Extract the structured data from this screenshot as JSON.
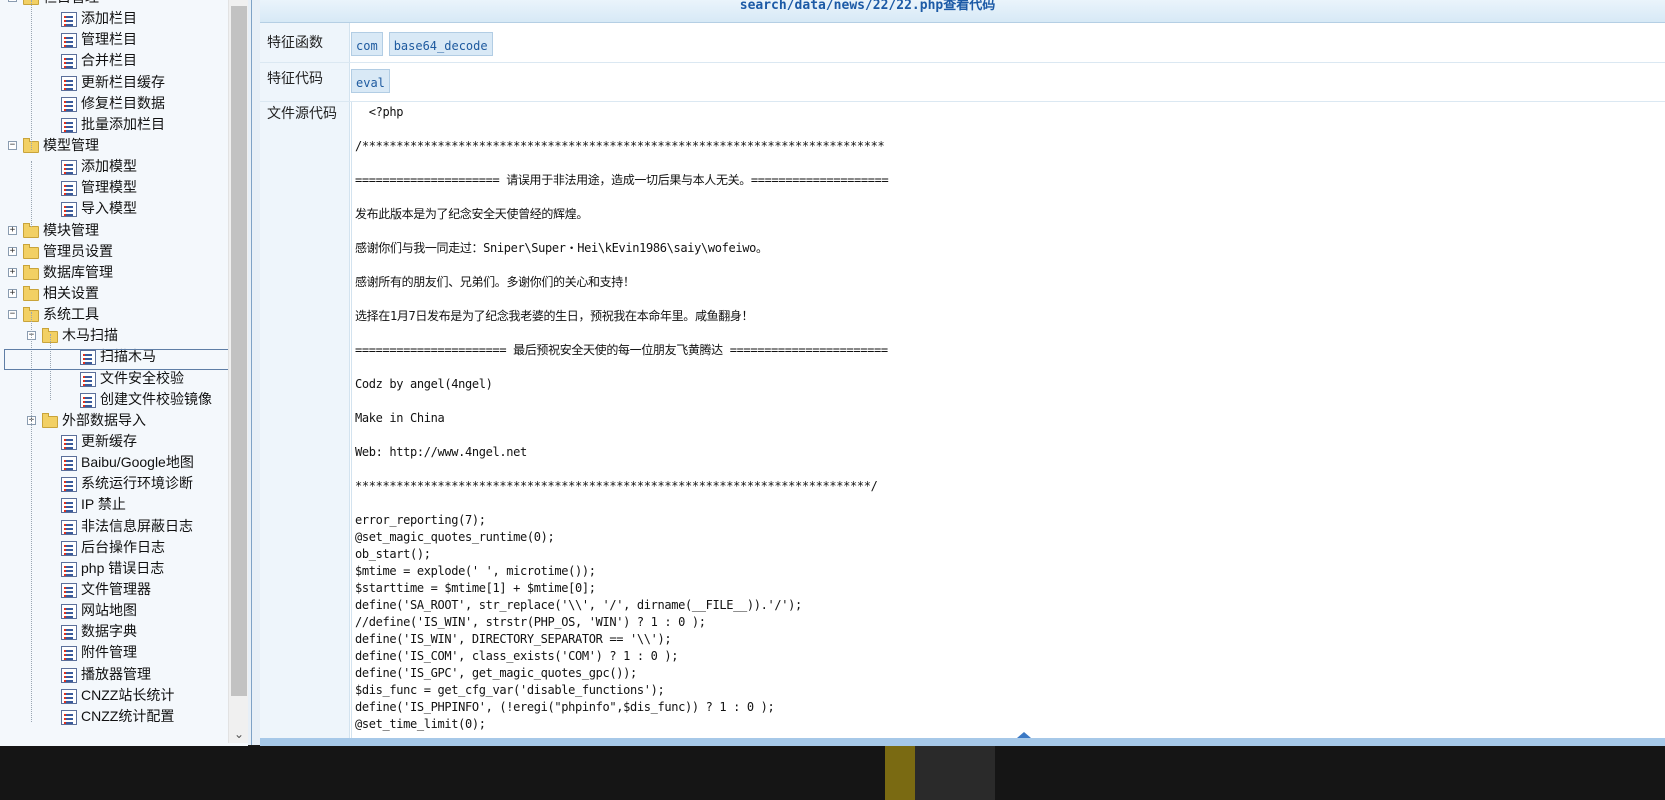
{
  "tree": {
    "items": [
      {
        "label": "栏目管理",
        "type": "folder",
        "level": 0,
        "expander": "−"
      },
      {
        "label": "添加栏目",
        "type": "page",
        "level": 1
      },
      {
        "label": "管理栏目",
        "type": "page",
        "level": 1
      },
      {
        "label": "合并栏目",
        "type": "page",
        "level": 1
      },
      {
        "label": "更新栏目缓存",
        "type": "page",
        "level": 1
      },
      {
        "label": "修复栏目数据",
        "type": "page",
        "level": 1
      },
      {
        "label": "批量添加栏目",
        "type": "page",
        "level": 1
      },
      {
        "label": "模型管理",
        "type": "folder",
        "level": 0,
        "expander": "−"
      },
      {
        "label": "添加模型",
        "type": "page",
        "level": 1
      },
      {
        "label": "管理模型",
        "type": "page",
        "level": 1
      },
      {
        "label": "导入模型",
        "type": "page",
        "level": 1
      },
      {
        "label": "模块管理",
        "type": "folder",
        "level": 0,
        "expander": "+"
      },
      {
        "label": "管理员设置",
        "type": "folder",
        "level": 0,
        "expander": "+"
      },
      {
        "label": "数据库管理",
        "type": "folder",
        "level": 0,
        "expander": "+"
      },
      {
        "label": "相关设置",
        "type": "folder",
        "level": 0,
        "expander": "+"
      },
      {
        "label": "系统工具",
        "type": "folder",
        "level": 0,
        "expander": "−"
      },
      {
        "label": "木马扫描",
        "type": "folder",
        "level": 1,
        "expander": "−"
      },
      {
        "label": "扫描木马",
        "type": "page",
        "level": 2,
        "selected": true
      },
      {
        "label": "文件安全校验",
        "type": "page",
        "level": 2
      },
      {
        "label": "创建文件校验镜像",
        "type": "page",
        "level": 2
      },
      {
        "label": "外部数据导入",
        "type": "folder",
        "level": 1,
        "expander": "+"
      },
      {
        "label": "更新缓存",
        "type": "page",
        "level": 1
      },
      {
        "label": "Baibu/Google地图",
        "type": "page",
        "level": 1
      },
      {
        "label": "系统运行环境诊断",
        "type": "page",
        "level": 1
      },
      {
        "label": "IP 禁止",
        "type": "page",
        "level": 1
      },
      {
        "label": "非法信息屏蔽日志",
        "type": "page",
        "level": 1
      },
      {
        "label": "后台操作日志",
        "type": "page",
        "level": 1
      },
      {
        "label": "php 错误日志",
        "type": "page",
        "level": 1
      },
      {
        "label": "文件管理器",
        "type": "page",
        "level": 1
      },
      {
        "label": "网站地图",
        "type": "page",
        "level": 1
      },
      {
        "label": "数据字典",
        "type": "page",
        "level": 1
      },
      {
        "label": "附件管理",
        "type": "page",
        "level": 1
      },
      {
        "label": "播放器管理",
        "type": "page",
        "level": 1
      },
      {
        "label": "CNZZ站长统计",
        "type": "page",
        "level": 1
      },
      {
        "label": "CNZZ统计配置",
        "type": "page",
        "level": 1
      }
    ]
  },
  "scrollbar": {
    "down_arrow": "⌄"
  },
  "content": {
    "title": "search/data/news/22/22.php查看代码",
    "feature_functions_label": "特征函数",
    "feature_functions": [
      "com",
      "base64_decode"
    ],
    "feature_code_label": "特征代码",
    "feature_code": [
      "eval"
    ],
    "source_label": "文件源代码",
    "source_lines": [
      "  <?php",
      "",
      "/****************************************************************************",
      "",
      "===================== 请误用于非法用途，造成一切后果与本人无关。====================",
      "",
      "发布此版本是为了纪念安全天使曾经的辉煌。",
      "",
      "感谢你们与我一同走过：Sniper\\Super・Hei\\kEvin1986\\saiy\\wofeiwo。",
      "",
      "感谢所有的朋友们、兄弟们。多谢你们的关心和支持！",
      "",
      "选择在1月7日发布是为了纪念我老婆的生日，预祝我在本命年里。咸鱼翻身！",
      "",
      "====================== 最后预祝安全天使的每一位朋友飞黄腾达 =======================",
      "",
      "Codz by angel(4ngel)",
      "",
      "Make in China",
      "",
      "Web: http://www.4ngel.net",
      "",
      "***************************************************************************/",
      "",
      "error_reporting(7);",
      "@set_magic_quotes_runtime(0);",
      "ob_start();",
      "$mtime = explode(' ', microtime());",
      "$starttime = $mtime[1] + $mtime[0];",
      "define('SA_ROOT', str_replace('\\\\', '/', dirname(__FILE__)).'/');",
      "//define('IS_WIN', strstr(PHP_OS, 'WIN') ? 1 : 0 );",
      "define('IS_WIN', DIRECTORY_SEPARATOR == '\\\\');",
      "define('IS_COM', class_exists('COM') ? 1 : 0 );",
      "define('IS_GPC', get_magic_quotes_gpc());",
      "$dis_func = get_cfg_var('disable_functions');",
      "define('IS_PHPINFO', (!eregi(\"phpinfo\",$dis_func)) ? 1 : 0 );",
      "@set_time_limit(0);"
    ]
  }
}
